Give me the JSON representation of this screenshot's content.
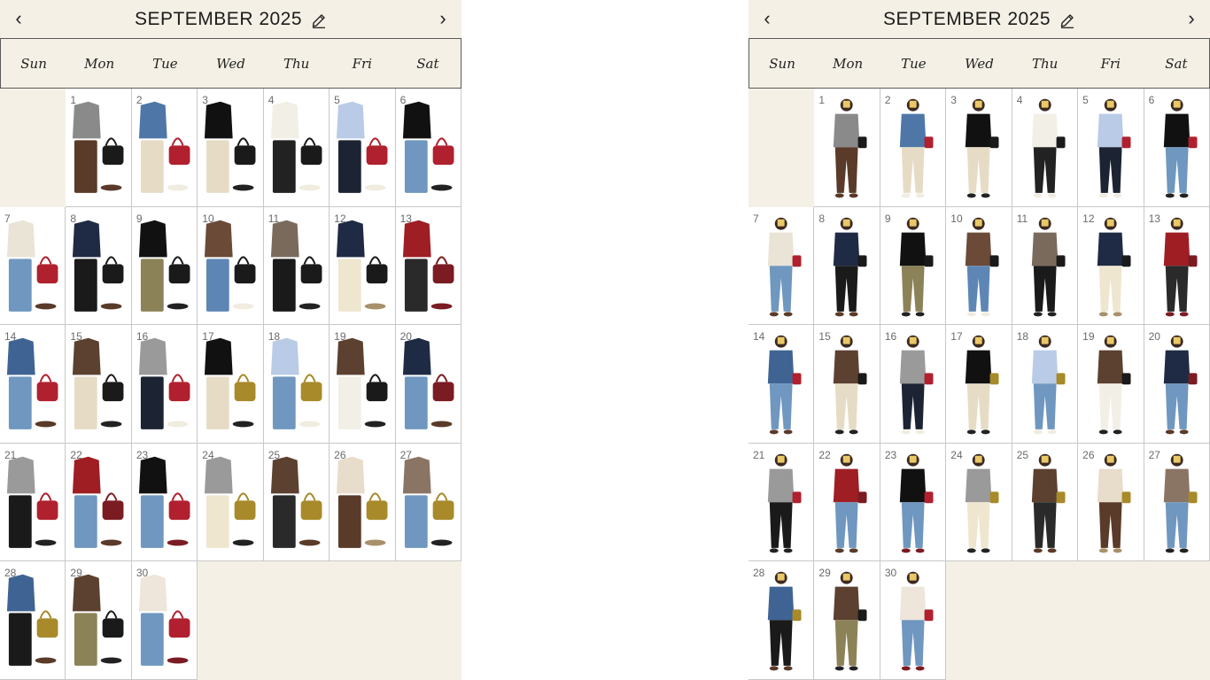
{
  "calendars": [
    {
      "id": "left",
      "variant": "flatlay",
      "title": "SEPTEMBER 2025",
      "icons": {
        "prev": "chevron-left-icon",
        "next": "chevron-right-icon",
        "edit": "pencil-icon"
      },
      "weekdays": [
        "Sun",
        "Mon",
        "Tue",
        "Wed",
        "Thu",
        "Fri",
        "Sat"
      ],
      "first_weekday_index": 1,
      "days": [
        "1",
        "2",
        "3",
        "4",
        "5",
        "6",
        "7",
        "8",
        "9",
        "10",
        "11",
        "12",
        "13",
        "14",
        "15",
        "16",
        "17",
        "18",
        "19",
        "20",
        "21",
        "22",
        "23",
        "24",
        "25",
        "26",
        "27",
        "28",
        "29",
        "30"
      ]
    },
    {
      "id": "right",
      "variant": "worn",
      "title": "SEPTEMBER 2025",
      "icons": {
        "prev": "chevron-left-icon",
        "next": "chevron-right-icon",
        "edit": "pencil-icon"
      },
      "weekdays": [
        "Sun",
        "Mon",
        "Tue",
        "Wed",
        "Thu",
        "Fri",
        "Sat"
      ],
      "first_weekday_index": 1,
      "days": [
        "1",
        "2",
        "3",
        "4",
        "5",
        "6",
        "7",
        "8",
        "9",
        "10",
        "11",
        "12",
        "13",
        "14",
        "15",
        "16",
        "17",
        "18",
        "19",
        "20",
        "21",
        "22",
        "23",
        "24",
        "25",
        "26",
        "27",
        "28",
        "29",
        "30"
      ]
    }
  ],
  "outfits": [
    {
      "top": "#8a8a8a",
      "bottom": "#5a3a28",
      "bag": "#1a1a1a",
      "shoe": "#5a3a28"
    },
    {
      "top": "#4e77a8",
      "bottom": "#e6dcc6",
      "bag": "#b0202e",
      "shoe": "#f0ece0"
    },
    {
      "top": "#111111",
      "bottom": "#e6dcc6",
      "bag": "#1a1a1a",
      "shoe": "#222222"
    },
    {
      "top": "#f2efe6",
      "bottom": "#222222",
      "bag": "#1a1a1a",
      "shoe": "#f0ece0"
    },
    {
      "top": "#b9cbe6",
      "bottom": "#1c2433",
      "bag": "#b0202e",
      "shoe": "#f0ece0"
    },
    {
      "top": "#111111",
      "bottom": "#6f97bf",
      "bag": "#b0202e",
      "shoe": "#222222"
    },
    {
      "top": "#eae4d6",
      "bottom": "#6f97bf",
      "bag": "#b0202e",
      "shoe": "#5a3a28"
    },
    {
      "top": "#1f2b44",
      "bottom": "#1a1a1a",
      "bag": "#1a1a1a",
      "shoe": "#5a3a28"
    },
    {
      "top": "#111111",
      "bottom": "#8c8258",
      "bag": "#1a1a1a",
      "shoe": "#222222"
    },
    {
      "top": "#6b4a38",
      "bottom": "#5e86b5",
      "bag": "#1a1a1a",
      "shoe": "#f0ece0"
    },
    {
      "top": "#7a6a5c",
      "bottom": "#1a1a1a",
      "bag": "#1a1a1a",
      "shoe": "#222222"
    },
    {
      "top": "#1f2b44",
      "bottom": "#efe6d0",
      "bag": "#1a1a1a",
      "shoe": "#a8906a"
    },
    {
      "top": "#9e1e24",
      "bottom": "#2a2a2a",
      "bag": "#7a1c22",
      "shoe": "#7a1c22"
    },
    {
      "top": "#3f6494",
      "bottom": "#6f97bf",
      "bag": "#b0202e",
      "shoe": "#5a3a28"
    },
    {
      "top": "#5c4030",
      "bottom": "#e6dcc6",
      "bag": "#1a1a1a",
      "shoe": "#222222"
    },
    {
      "top": "#9a9a9a",
      "bottom": "#1c2433",
      "bag": "#b0202e",
      "shoe": "#f0ece0"
    },
    {
      "top": "#111111",
      "bottom": "#e6dcc6",
      "bag": "#a88a2a",
      "shoe": "#222222"
    },
    {
      "top": "#b9cbe6",
      "bottom": "#6f97bf",
      "bag": "#a88a2a",
      "shoe": "#f0ece0"
    },
    {
      "top": "#5c4030",
      "bottom": "#f2efe6",
      "bag": "#1a1a1a",
      "shoe": "#222222"
    },
    {
      "top": "#1f2b44",
      "bottom": "#6f97bf",
      "bag": "#7a1c22",
      "shoe": "#5a3a28"
    },
    {
      "top": "#9a9a9a",
      "bottom": "#1a1a1a",
      "bag": "#b0202e",
      "shoe": "#222222"
    },
    {
      "top": "#9e1e24",
      "bottom": "#6f97bf",
      "bag": "#7a1c22",
      "shoe": "#5a3a28"
    },
    {
      "top": "#111111",
      "bottom": "#6f97bf",
      "bag": "#b0202e",
      "shoe": "#7a1c22"
    },
    {
      "top": "#9a9a9a",
      "bottom": "#efe6d0",
      "bag": "#a88a2a",
      "shoe": "#222222"
    },
    {
      "top": "#5c4030",
      "bottom": "#2a2a2a",
      "bag": "#a88a2a",
      "shoe": "#5a3a28"
    },
    {
      "top": "#e8dccb",
      "bottom": "#5a3a28",
      "bag": "#a88a2a",
      "shoe": "#a8906a"
    },
    {
      "top": "#8a7464",
      "bottom": "#6f97bf",
      "bag": "#a88a2a",
      "shoe": "#222222"
    },
    {
      "top": "#3f6494",
      "bottom": "#1a1a1a",
      "bag": "#a88a2a",
      "shoe": "#5a3a28"
    },
    {
      "top": "#5c4030",
      "bottom": "#8c8258",
      "bag": "#1a1a1a",
      "shoe": "#222222"
    },
    {
      "top": "#eee6da",
      "bottom": "#6f97bf",
      "bag": "#b0202e",
      "shoe": "#7a1c22"
    }
  ]
}
